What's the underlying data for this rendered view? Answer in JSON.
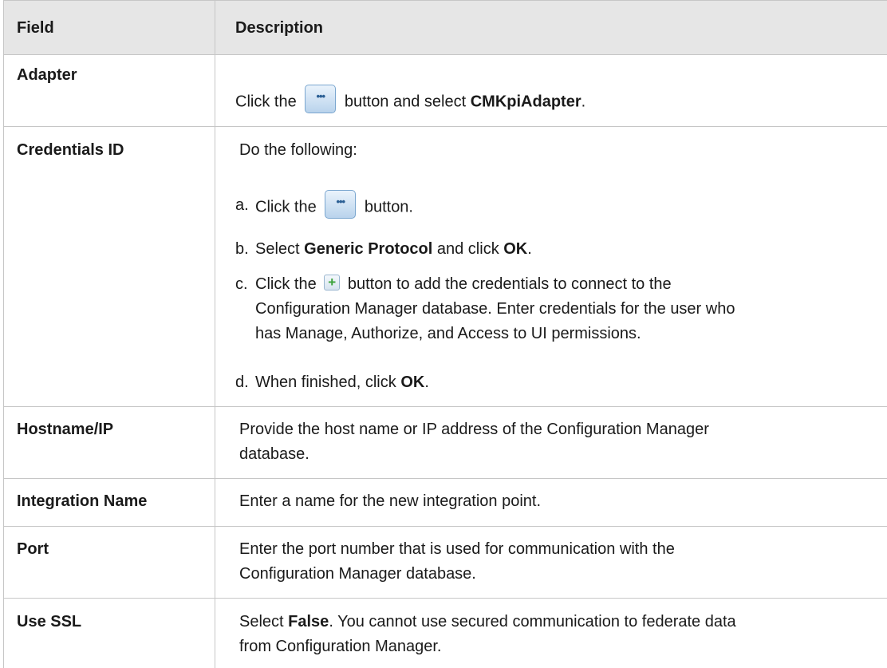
{
  "header": {
    "field": "Field",
    "description": "Description"
  },
  "rows": {
    "adapter": {
      "field": "Adapter",
      "pre": "Click the",
      "mid": "button and select",
      "bold": "CMKpiAdapter",
      "end": "."
    },
    "credentials": {
      "field": "Credentials ID",
      "intro": "Do the following:",
      "a": {
        "mark": "a.",
        "pre": "Click the",
        "post": "button."
      },
      "b": {
        "mark": "b.",
        "pre": "Select",
        "bold1": "Generic Protocol",
        "mid": "and click",
        "bold2": "OK",
        "end": "."
      },
      "c": {
        "mark": "c.",
        "pre": "Click the",
        "line1": "button to add the credentials to connect to the",
        "line2": "Configuration Manager database. Enter credentials for the user who",
        "line3": "has Manage, Authorize, and Access to UI permissions."
      },
      "d": {
        "mark": "d.",
        "pre": "When finished, click",
        "bold": "OK",
        "end": "."
      }
    },
    "hostname": {
      "field": "Hostname/IP",
      "line1": "Provide the host name or IP address of the Configuration Manager",
      "line2": "database."
    },
    "integration": {
      "field": "Integration Name",
      "text": "Enter a name for the new integration point."
    },
    "port": {
      "field": "Port",
      "line1": "Enter the port number that is used for communication with the",
      "line2": "Configuration Manager database."
    },
    "ssl": {
      "field": "Use SSL",
      "pre": "Select",
      "bold": "False",
      "line1rest": ". You cannot use secured communication to federate data",
      "line2": "from Configuration Manager."
    }
  },
  "icons": {
    "ellipsis": "ellipsis-button-icon",
    "add": "add-plus-icon"
  },
  "colors": {
    "header_bg": "#e6e6e6",
    "border": "#c6c6c6",
    "button_blue": "#7aa6cf",
    "plus_green": "#3aa23a"
  }
}
